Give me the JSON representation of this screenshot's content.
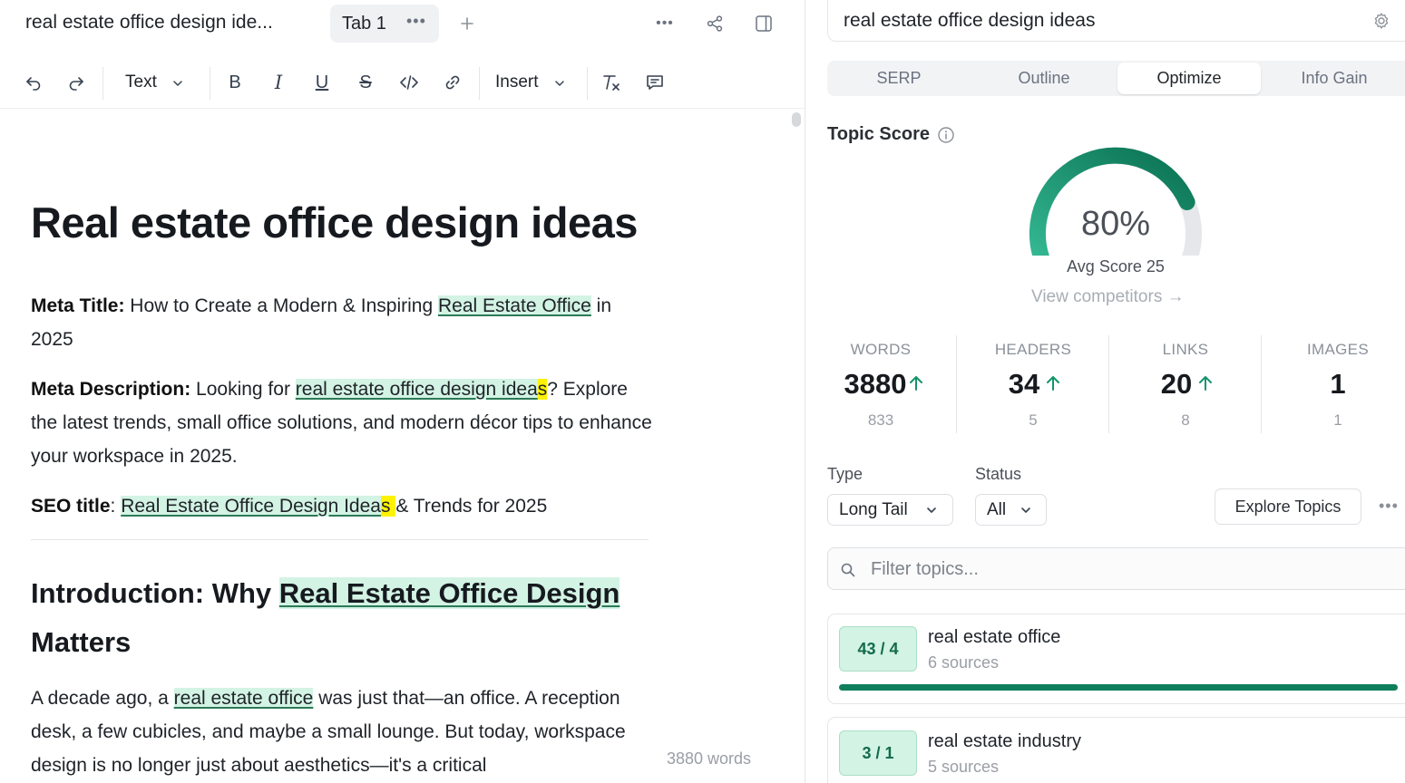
{
  "editor": {
    "doc_title": "real estate office design ide...",
    "tab_label": "Tab 1",
    "toolbar": {
      "text_style": "Text",
      "insert_label": "Insert"
    },
    "word_count": "3880 words"
  },
  "document": {
    "h1": "Real estate office design ideas",
    "meta_title": {
      "label": "Meta Title:",
      "pre": " How to Create a Modern & Inspiring ",
      "kw": "Real Estate Office",
      "post": " in 2025"
    },
    "meta_description": {
      "label": "Meta Description:",
      "pre": " Looking for ",
      "kw": "real estate office design idea",
      "kw_flag": "s",
      "post": "? Explore the latest trends, small office solutions, and modern décor tips to enhance your workspace in 2025."
    },
    "seo_title": {
      "label": "SEO title",
      "sep": ": ",
      "kw": "Real Estate Office Design Idea",
      "kw_flag": "s ",
      "post": "& Trends for 2025"
    },
    "h2": {
      "pre": "Introduction: Why ",
      "kw": "Real Estate Office Design",
      "post": " Matters"
    },
    "intro": {
      "pre": "A decade ago, a ",
      "kw": "real estate office",
      "post": " was just that—an office. A reception desk, a few cubicles, and maybe a small lounge. But today, workspace design is no longer just about aesthetics—it's a critical"
    }
  },
  "panel": {
    "query": "real estate office design ideas",
    "tabs": [
      "SERP",
      "Outline",
      "Optimize",
      "Info Gain"
    ],
    "active_tab": "Optimize",
    "topic_score_label": "Topic Score",
    "score": 80,
    "score_text": "80%",
    "avg_score_text": "Avg Score 25",
    "view_competitors": "View competitors →",
    "stats": [
      {
        "label": "WORDS",
        "value": "3880",
        "target": "833",
        "up": true
      },
      {
        "label": "HEADERS",
        "value": "34",
        "target": "5",
        "up": true
      },
      {
        "label": "LINKS",
        "value": "20",
        "target": "8",
        "up": true
      },
      {
        "label": "IMAGES",
        "value": "1",
        "target": "1",
        "up": false
      }
    ],
    "type_label": "Type",
    "type_value": "Long Tail",
    "status_label": "Status",
    "status_value": "All",
    "explore_button": "Explore Topics",
    "filter_placeholder": "Filter topics...",
    "topics": [
      {
        "badge": "43 / 4",
        "name": "real estate office",
        "sources": "6 sources",
        "progress": 1.0
      },
      {
        "badge": "3 / 1",
        "name": "real estate industry",
        "sources": "5 sources",
        "progress": null
      }
    ],
    "colors": {
      "accent": "#0f7e5c",
      "highlight": "#d3f3e4",
      "flag": "#fef200"
    }
  }
}
